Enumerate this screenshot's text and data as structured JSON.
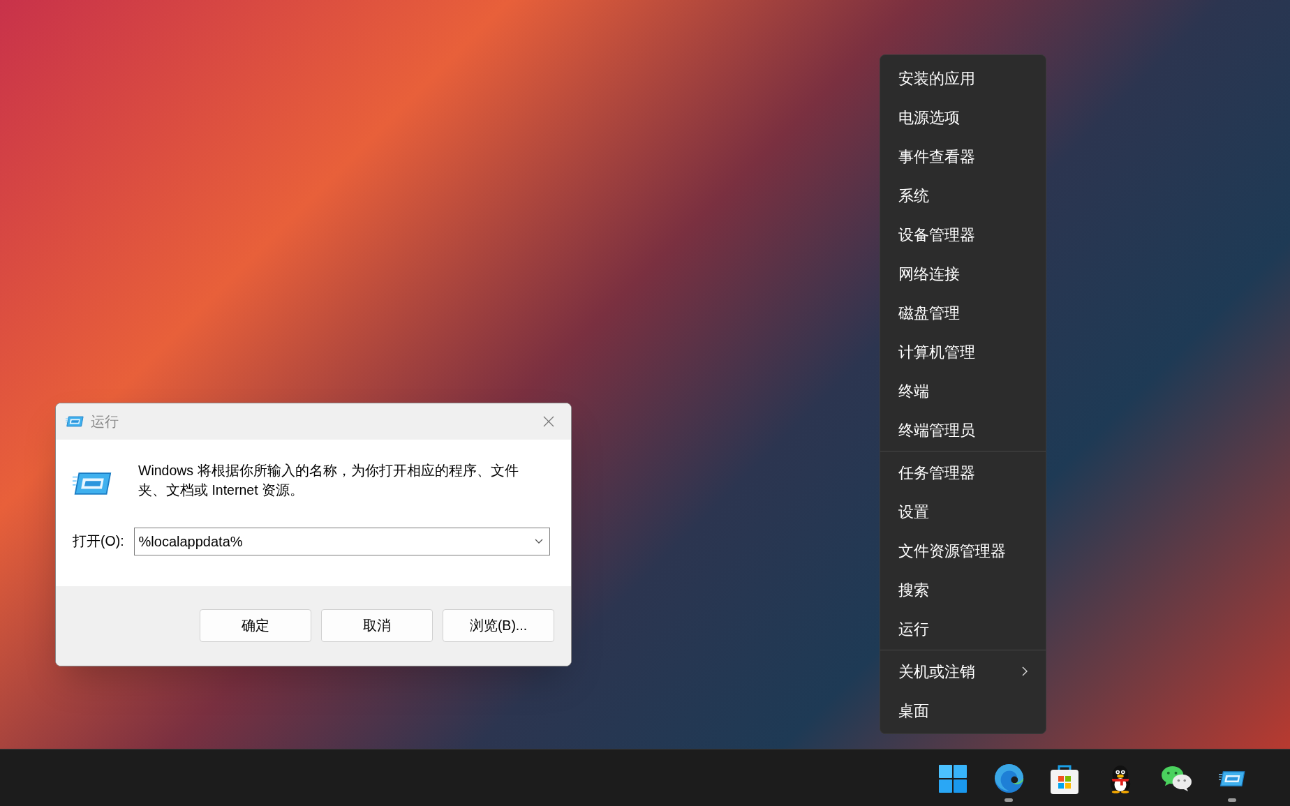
{
  "run_dialog": {
    "title": "运行",
    "description": "Windows 将根据你所输入的名称，为你打开相应的程序、文件夹、文档或 Internet 资源。",
    "open_label": "打开(O):",
    "open_value": "%localappdata%",
    "buttons": [
      "确定",
      "取消",
      "浏览(B)..."
    ]
  },
  "context_menu": {
    "groups": [
      [
        {
          "label": "安装的应用",
          "has_submenu": false
        },
        {
          "label": "电源选项",
          "has_submenu": false
        },
        {
          "label": "事件查看器",
          "has_submenu": false
        },
        {
          "label": "系统",
          "has_submenu": false
        },
        {
          "label": "设备管理器",
          "has_submenu": false
        },
        {
          "label": "网络连接",
          "has_submenu": false
        },
        {
          "label": "磁盘管理",
          "has_submenu": false
        },
        {
          "label": "计算机管理",
          "has_submenu": false
        },
        {
          "label": "终端",
          "has_submenu": false
        },
        {
          "label": "终端管理员",
          "has_submenu": false
        }
      ],
      [
        {
          "label": "任务管理器",
          "has_submenu": false
        },
        {
          "label": "设置",
          "has_submenu": false
        },
        {
          "label": "文件资源管理器",
          "has_submenu": false
        },
        {
          "label": "搜索",
          "has_submenu": false
        },
        {
          "label": "运行",
          "has_submenu": false
        }
      ],
      [
        {
          "label": "关机或注销",
          "has_submenu": true
        },
        {
          "label": "桌面",
          "has_submenu": false
        }
      ]
    ]
  },
  "taskbar": {
    "apps": [
      {
        "kind": "start",
        "running": false
      },
      {
        "kind": "browser",
        "running": true
      },
      {
        "kind": "store",
        "running": false
      },
      {
        "kind": "penguin",
        "running": false
      },
      {
        "kind": "chat",
        "running": false
      },
      {
        "kind": "run",
        "running": true
      }
    ]
  }
}
